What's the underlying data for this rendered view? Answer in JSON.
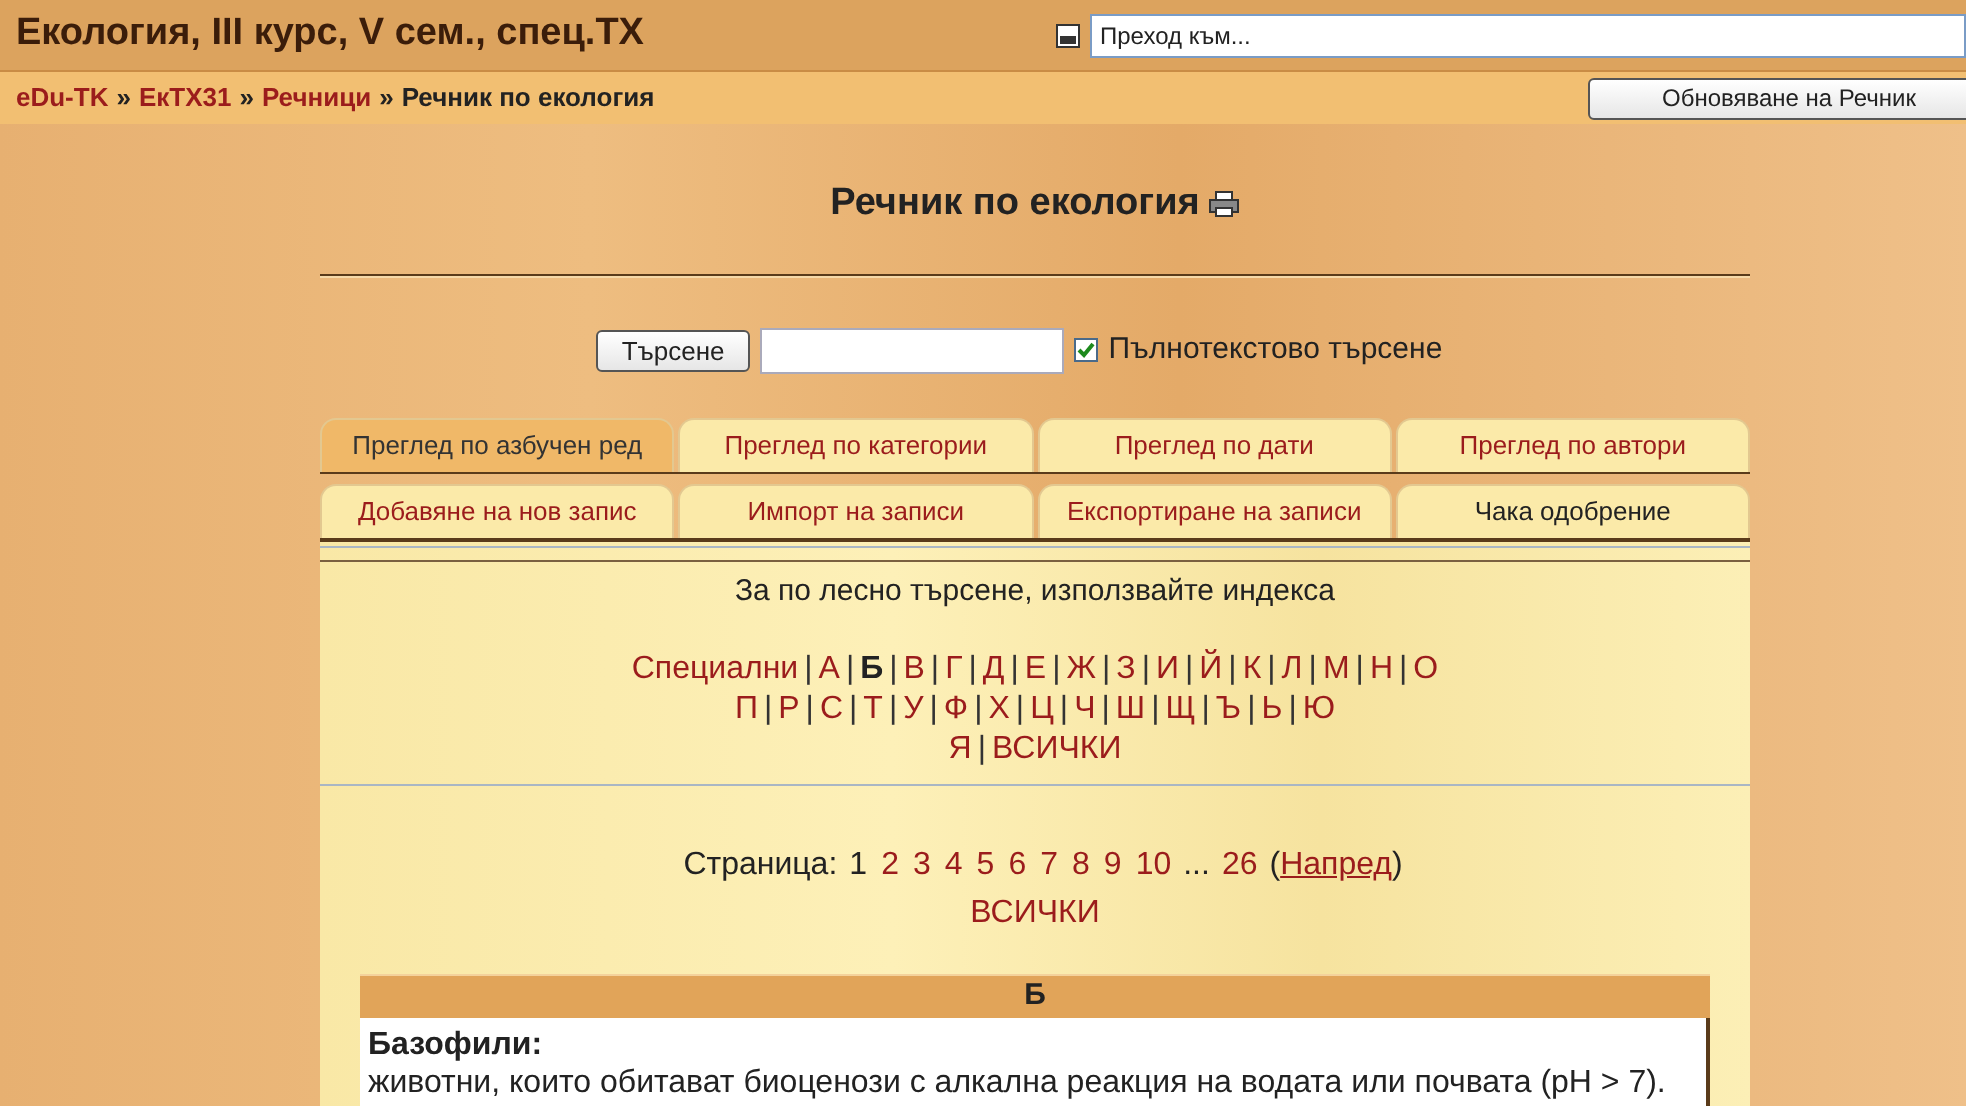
{
  "header": {
    "title": "Екология, III курс, V сем., спец.ТХ",
    "jump": {
      "placeholder": "Преход към..."
    }
  },
  "breadcrumb": [
    {
      "label": "eDu-TK",
      "link": true
    },
    {
      "label": "ЕкТХ31",
      "link": true
    },
    {
      "label": "Речници",
      "link": true
    },
    {
      "label": "Речник по екология",
      "link": false
    }
  ],
  "breadcrumb_separator": "»",
  "update_button": "Обновяване на Речник",
  "heading": "Речник по екология",
  "search": {
    "button": "Търсене",
    "fulltext": {
      "label": "Пълнотекстово търсене",
      "checked": true
    }
  },
  "tabs_row1": [
    {
      "label": "Преглед по азбучен ред",
      "selected": true
    },
    {
      "label": "Преглед по категории",
      "selected": false
    },
    {
      "label": "Преглед по дати",
      "selected": false
    },
    {
      "label": "Преглед по автори",
      "selected": false
    }
  ],
  "tabs_row2": [
    {
      "label": "Добавяне на нов запис",
      "disabled": false
    },
    {
      "label": "Импорт на записи",
      "disabled": false
    },
    {
      "label": "Експортиране на записи",
      "disabled": false
    },
    {
      "label": "Чака одобрение",
      "disabled": true
    }
  ],
  "index_hint": "За по лесно търсене, използвайте индекса",
  "index_lines": [
    [
      {
        "label": "Специални",
        "selected": false
      },
      {
        "label": "А",
        "selected": false
      },
      {
        "label": "Б",
        "selected": true
      },
      {
        "label": "В",
        "selected": false
      },
      {
        "label": "Г",
        "selected": false
      },
      {
        "label": "Д",
        "selected": false
      },
      {
        "label": "Е",
        "selected": false
      },
      {
        "label": "Ж",
        "selected": false
      },
      {
        "label": "З",
        "selected": false
      },
      {
        "label": "И",
        "selected": false
      },
      {
        "label": "Й",
        "selected": false
      },
      {
        "label": "К",
        "selected": false
      },
      {
        "label": "Л",
        "selected": false
      },
      {
        "label": "М",
        "selected": false
      },
      {
        "label": "Н",
        "selected": false
      },
      {
        "label": "О",
        "selected": false
      }
    ],
    [
      {
        "label": "П",
        "selected": false
      },
      {
        "label": "Р",
        "selected": false
      },
      {
        "label": "С",
        "selected": false
      },
      {
        "label": "Т",
        "selected": false
      },
      {
        "label": "У",
        "selected": false
      },
      {
        "label": "Ф",
        "selected": false
      },
      {
        "label": "Х",
        "selected": false
      },
      {
        "label": "Ц",
        "selected": false
      },
      {
        "label": "Ч",
        "selected": false
      },
      {
        "label": "Ш",
        "selected": false
      },
      {
        "label": "Щ",
        "selected": false
      },
      {
        "label": "Ъ",
        "selected": false
      },
      {
        "label": "Ь",
        "selected": false
      },
      {
        "label": "Ю",
        "selected": false
      }
    ],
    [
      {
        "label": "Я",
        "selected": false
      },
      {
        "label": "ВСИЧКИ",
        "selected": false
      }
    ]
  ],
  "separator": "|",
  "pagination": {
    "label": "Страница:",
    "pages": [
      {
        "label": "1",
        "selected": true
      },
      {
        "label": "2",
        "selected": false
      },
      {
        "label": "3",
        "selected": false
      },
      {
        "label": "4",
        "selected": false
      },
      {
        "label": "5",
        "selected": false
      },
      {
        "label": "6",
        "selected": false
      },
      {
        "label": "7",
        "selected": false
      },
      {
        "label": "8",
        "selected": false
      },
      {
        "label": "9",
        "selected": false
      },
      {
        "label": "10",
        "selected": false
      }
    ],
    "ellipsis": "...",
    "last": "26",
    "open_paren": "(",
    "next": "Напред",
    "close_paren": ")",
    "all": "ВСИЧКИ"
  },
  "section": {
    "letter": "Б",
    "entries": [
      {
        "term": "Базофили:",
        "definition": "животни, които обитават биоценози с алкална реакция на водата или почвата (pH > 7)."
      }
    ]
  }
}
